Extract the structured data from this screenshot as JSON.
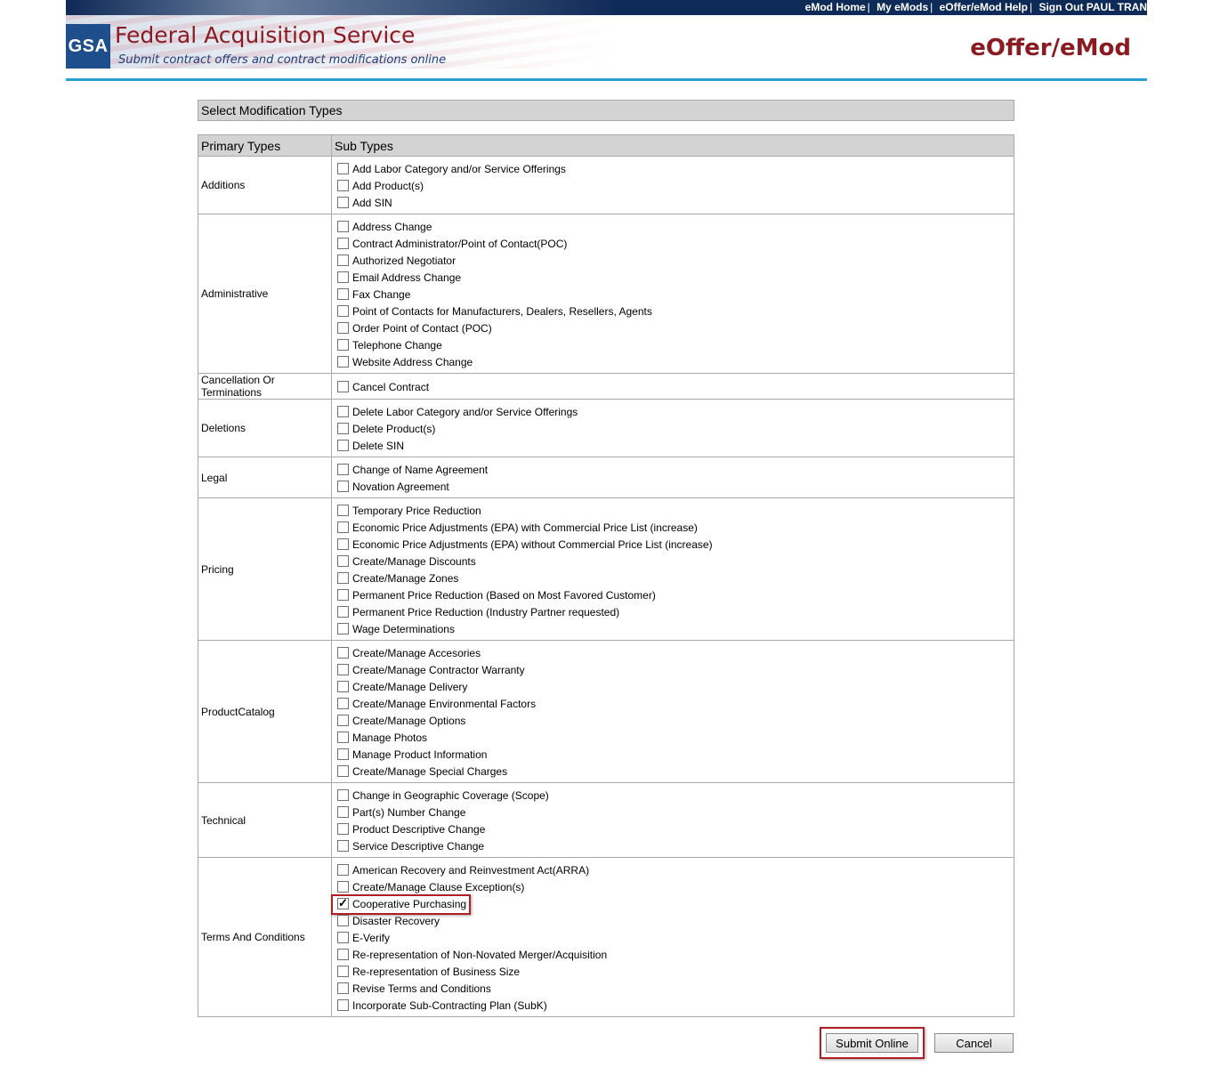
{
  "header": {
    "links": [
      "eMod Home",
      "My eMods",
      "eOffer/eMod Help",
      "Sign Out PAUL TRAN"
    ],
    "logo_text": "GSA",
    "title": "Federal Acquisition Service",
    "subtitle": "Submit contract offers and contract modifications online",
    "app_name": "eOffer/eMod"
  },
  "section_title": "Select Modification Types",
  "table": {
    "col_primary": "Primary Types",
    "col_sub": "Sub Types",
    "groups": [
      {
        "primary": "Additions",
        "subs": [
          "Add Labor Category and/or Service Offerings",
          "Add Product(s)",
          "Add SIN"
        ]
      },
      {
        "primary": "Administrative",
        "subs": [
          "Address Change",
          "Contract Administrator/Point of Contact(POC)",
          "Authorized Negotiator",
          "Email Address Change",
          "Fax Change",
          "Point of Contacts for Manufacturers, Dealers, Resellers, Agents",
          "Order Point of Contact (POC)",
          "Telephone Change",
          "Website Address Change"
        ]
      },
      {
        "primary": "Cancellation Or Terminations",
        "subs": [
          "Cancel Contract"
        ]
      },
      {
        "primary": "Deletions",
        "subs": [
          "Delete Labor Category and/or Service Offerings",
          "Delete Product(s)",
          "Delete SIN"
        ]
      },
      {
        "primary": "Legal",
        "subs": [
          "Change of Name Agreement",
          "Novation Agreement"
        ]
      },
      {
        "primary": "Pricing",
        "subs": [
          "Temporary Price Reduction",
          "Economic Price Adjustments (EPA) with Commercial Price List (increase)",
          "Economic Price Adjustments (EPA) without Commercial Price List (increase)",
          "Create/Manage Discounts",
          "Create/Manage Zones",
          "Permanent Price Reduction (Based on Most Favored Customer)",
          "Permanent Price Reduction (Industry Partner requested)",
          "Wage Determinations"
        ]
      },
      {
        "primary": "ProductCatalog",
        "subs": [
          "Create/Manage Accesories",
          "Create/Manage Contractor Warranty",
          "Create/Manage Delivery",
          "Create/Manage Environmental Factors",
          "Create/Manage Options",
          "Manage Photos",
          "Manage Product Information",
          "Create/Manage Special Charges"
        ]
      },
      {
        "primary": "Technical",
        "subs": [
          "Change in Geographic Coverage (Scope)",
          "Part(s) Number Change",
          "Product Descriptive Change",
          "Service Descriptive Change"
        ]
      },
      {
        "primary": "Terms And Conditions",
        "subs": [
          "American Recovery and Reinvestment Act(ARRA)",
          "Create/Manage Clause Exception(s)",
          "Cooperative Purchasing",
          "Disaster Recovery",
          "E-Verify",
          "Re-representation of Non-Novated Merger/Acquisition",
          "Re-representation of Business Size",
          "Revise Terms and Conditions",
          "Incorporate Sub-Contracting Plan (SubK)"
        ]
      }
    ],
    "checked": [
      "Cooperative Purchasing"
    ]
  },
  "buttons": {
    "submit": "Submit Online",
    "cancel": "Cancel"
  },
  "colors": {
    "brand_red": "#8b1b22",
    "navy": "#0e2a57",
    "accent_blue": "#2aa0d6",
    "highlight_red": "#b01e23"
  }
}
